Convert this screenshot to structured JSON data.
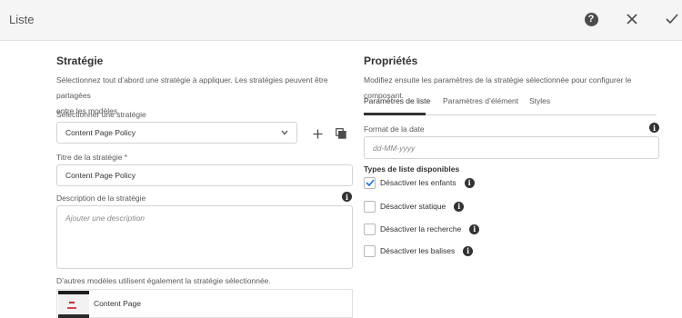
{
  "dialog": {
    "title": "Liste",
    "icons": {
      "help": "help-icon",
      "close": "close-icon",
      "done": "checkmark-icon"
    }
  },
  "strategy": {
    "heading": "Stratégie",
    "description_line1": "Sélectionnez tout d’abord une stratégie à appliquer. Les stratégies peuvent être partagées",
    "description_line2": "entre les modèles.",
    "select_label": "Sélectionner une stratégie",
    "select_value": "Content Page Policy",
    "title_label": "Titre de la stratégie *",
    "title_value": "Content Page Policy",
    "desc_label": "Description de la stratégie",
    "desc_placeholder": "Ajouter une description",
    "shared_label": "D’autres modèles utilisent également la stratégie sélectionnée.",
    "shared_templates": [
      "Content Page"
    ]
  },
  "properties": {
    "heading": "Propriétés",
    "description": "Modifiez ensuite les paramètres de la stratégie sélectionnée pour configurer le composant.",
    "tabs": [
      "Paramètres de liste",
      "Paramètres d’élément",
      "Styles"
    ],
    "active_tab": "Paramètres de liste",
    "date_label": "Format de la date",
    "date_placeholder": "dd-MM-yyyy",
    "list_types_heading": "Types de liste disponibles",
    "options": [
      {
        "label": "Désactiver les enfants",
        "checked": true
      },
      {
        "label": "Désactiver statique",
        "checked": false
      },
      {
        "label": "Désactiver la recherche",
        "checked": false
      },
      {
        "label": "Désactiver les balises",
        "checked": false
      }
    ]
  },
  "colors": {
    "header_bg": "#f5f5f5",
    "text": "#323232",
    "border": "#d3d3d3"
  }
}
